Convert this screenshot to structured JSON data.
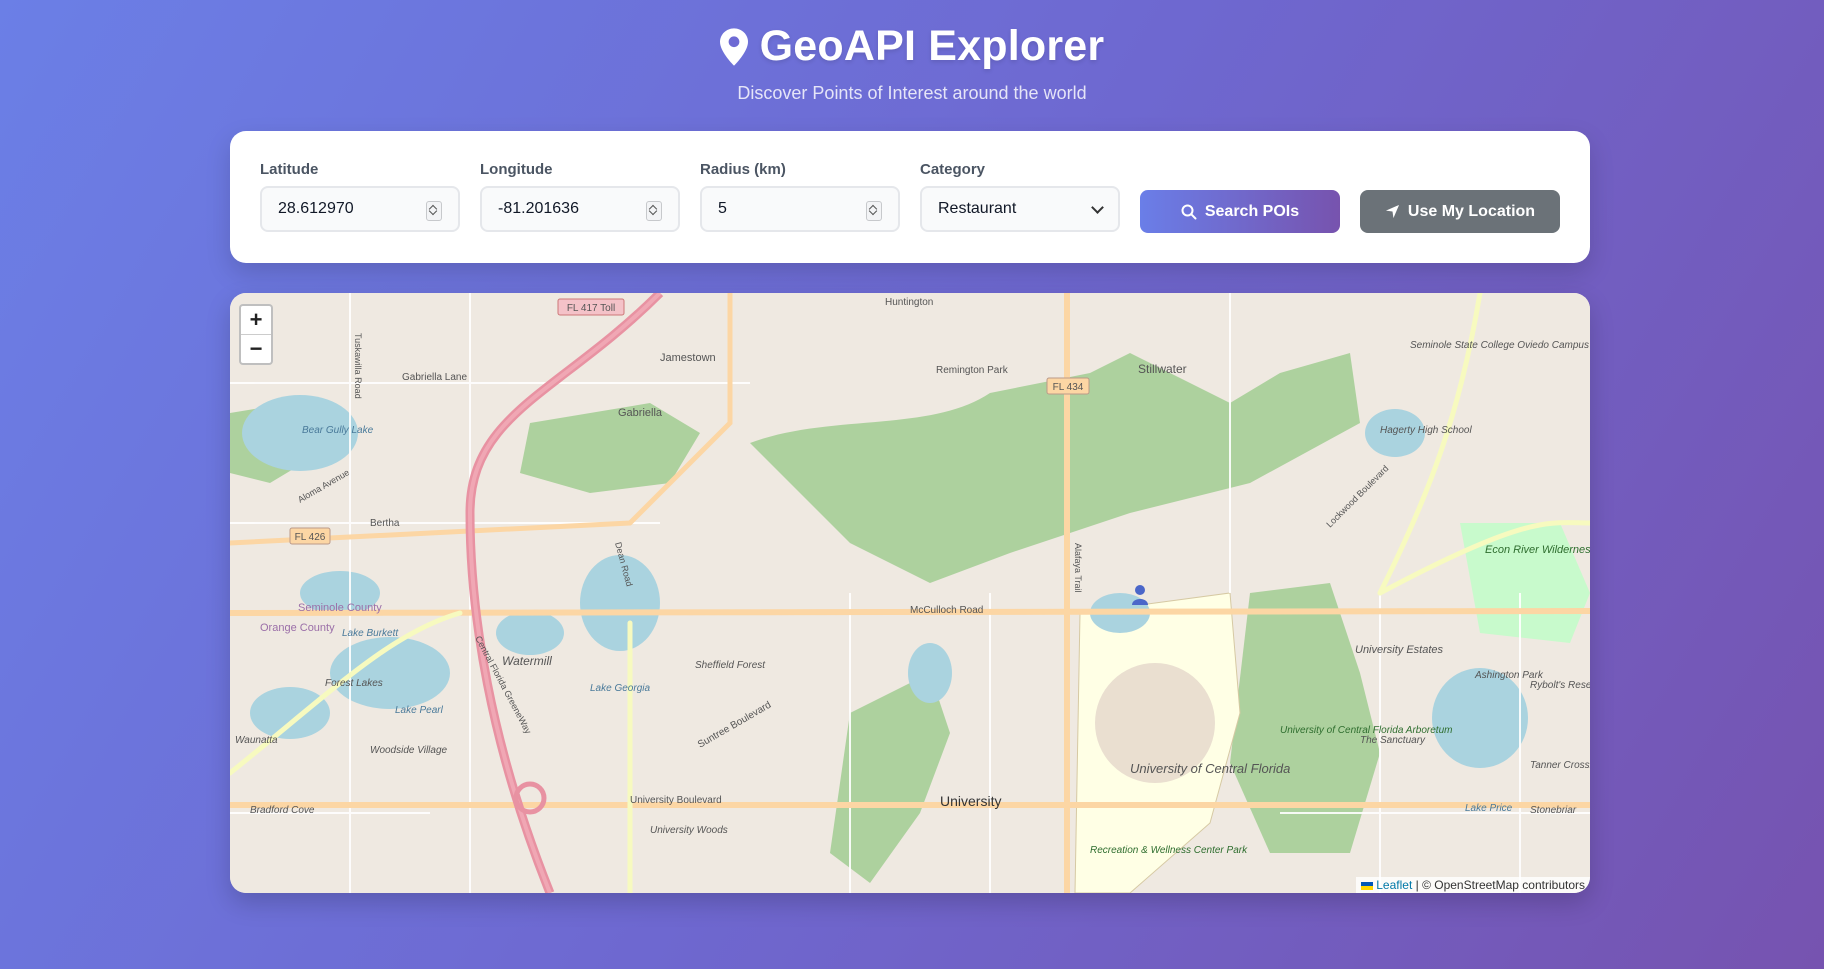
{
  "header": {
    "title": "GeoAPI Explorer",
    "subtitle": "Discover Points of Interest around the world"
  },
  "form": {
    "latitude": {
      "label": "Latitude",
      "value": "28.612970"
    },
    "longitude": {
      "label": "Longitude",
      "value": "-81.201636"
    },
    "radius": {
      "label": "Radius (km)",
      "value": "5"
    },
    "category": {
      "label": "Category",
      "value": "Restaurant"
    },
    "search_label": "Search POIs",
    "location_label": "Use My Location"
  },
  "map": {
    "zoom_in": "+",
    "zoom_out": "−",
    "attribution_link": "Leaflet",
    "attribution_text": "| © OpenStreetMap contributors",
    "labels": {
      "fl417": "FL 417 Toll",
      "fl434": "FL 434",
      "fl426": "FL 426",
      "jamestown": "Jamestown",
      "gabriella": "Gabriella",
      "gabriella_lane": "Gabriella Lane",
      "huntington": "Huntington",
      "remington": "Remington Park",
      "stillwater": "Stillwater",
      "seminole_college": "Seminole State College Oviedo Campus",
      "hagerty": "Hagerty High School",
      "bear_gully": "Bear Gully Lake",
      "bertha": "Bertha",
      "aloma": "Aloma Avenue",
      "seminole_county": "Seminole County",
      "orange_county": "Orange County",
      "lake_burkett": "Lake Burkett",
      "forest_lakes": "Forest Lakes",
      "lake_pearl": "Lake Pearl",
      "waunatta": "Waunatta",
      "woodside": "Woodside Village",
      "bradford": "Bradford Cove",
      "watermill": "Watermill",
      "lake_georgia": "Lake Georgia",
      "sheffield": "Sheffield Forest",
      "suntree": "Suntree Boulevard",
      "mcculloch": "McCulloch Road",
      "dean": "Dean Road",
      "greeneway": "Central Florida GreeneWay",
      "alafaya": "Alafaya Trail",
      "university": "University",
      "university_blvd": "University Boulevard",
      "ucf": "University of Central Florida",
      "ucf_arboretum": "University of Central Florida Arboretum",
      "recreation": "Recreation & Wellness Center Park",
      "university_estates": "University Estates",
      "sanctuary": "The Sanctuary",
      "ashington": "Ashington Park",
      "rybolts": "Rybolt's Reserve",
      "tanner": "Tanner Crossings",
      "stonebriar": "Stonebriar",
      "lake_price": "Lake Price",
      "econ": "Econ River Wilderness Area",
      "lockwood": "Lockwood Boulevard",
      "univ_woods": "University Woods",
      "tuskawilla": "Tuskawilla Road"
    }
  },
  "colors": {
    "accent_start": "#6a7ee8",
    "accent_end": "#7753ae",
    "secondary": "#6b7278"
  }
}
